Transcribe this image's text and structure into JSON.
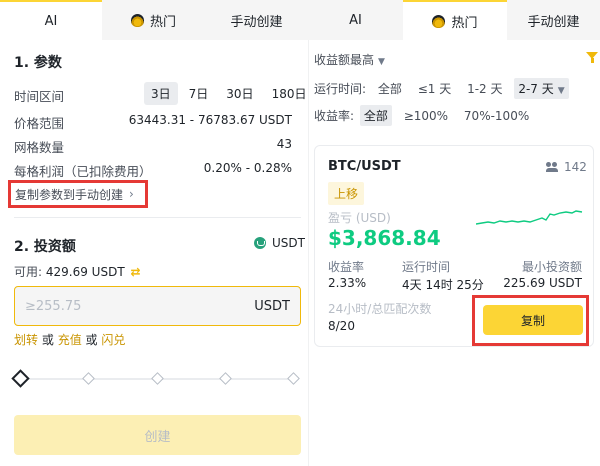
{
  "tabs_left": [
    {
      "label": "AI",
      "active": true
    },
    {
      "label": "热门",
      "icon": "flame-icon"
    },
    {
      "label": "手动创建"
    }
  ],
  "tabs_right": [
    {
      "label": "AI"
    },
    {
      "label": "热门",
      "icon": "flame-icon",
      "active": true
    },
    {
      "label": "手动创建"
    }
  ],
  "params": {
    "title": "1. 参数",
    "time_label": "时间区间",
    "periods": [
      "3日",
      "7日",
      "30日",
      "180日"
    ],
    "selected_period": "3日",
    "price_range_label": "价格范围",
    "price_range_value": "63443.31 - 76783.67 USDT",
    "grid_count_label": "网格数量",
    "grid_count_value": "43",
    "profit_label": "每格利润（已扣除费用）",
    "profit_value": "0.20% - 0.28%",
    "copy_params_label": "复制参数到手动创建"
  },
  "investment": {
    "title": "2. 投资额",
    "currency": "USDT",
    "available_label": "可用:",
    "available_value": "429.69 USDT",
    "input_placeholder": "≥255.75",
    "input_unit": "USDT",
    "link_transfer": "划转",
    "or1": "或",
    "link_deposit": "充值",
    "or2": "或",
    "link_flash": "闪兑",
    "create_label": "创建"
  },
  "filters": {
    "sort_label": "收益额最高",
    "runtime_label": "运行时间:",
    "runtime_options": [
      "全部",
      "≤1 天",
      "1-2 天",
      "2-7 天"
    ],
    "runtime_selected": "2-7 天",
    "yield_label": "收益率:",
    "yield_options": [
      "全部",
      "≥100%",
      "70%-100%"
    ],
    "yield_selected": "全部"
  },
  "card": {
    "pair": "BTC/USDT",
    "users": "142",
    "badge": "上移",
    "pnl_label": "盈亏 (USD)",
    "pnl_value": "$3,868.84",
    "yield_label": "收益率",
    "yield_value": "2.33%",
    "runtime_label": "运行时间",
    "runtime_value": "4天 14时 25分",
    "min_invest_label": "最小投资额",
    "min_invest_value": "225.69 USDT",
    "trades_label": "24小时/总匹配次数",
    "trades_value": "8/20",
    "copy_label": "复制"
  },
  "colors": {
    "accent": "#fcd535",
    "green": "#0ecb81",
    "highlight_box": "#e53935"
  }
}
